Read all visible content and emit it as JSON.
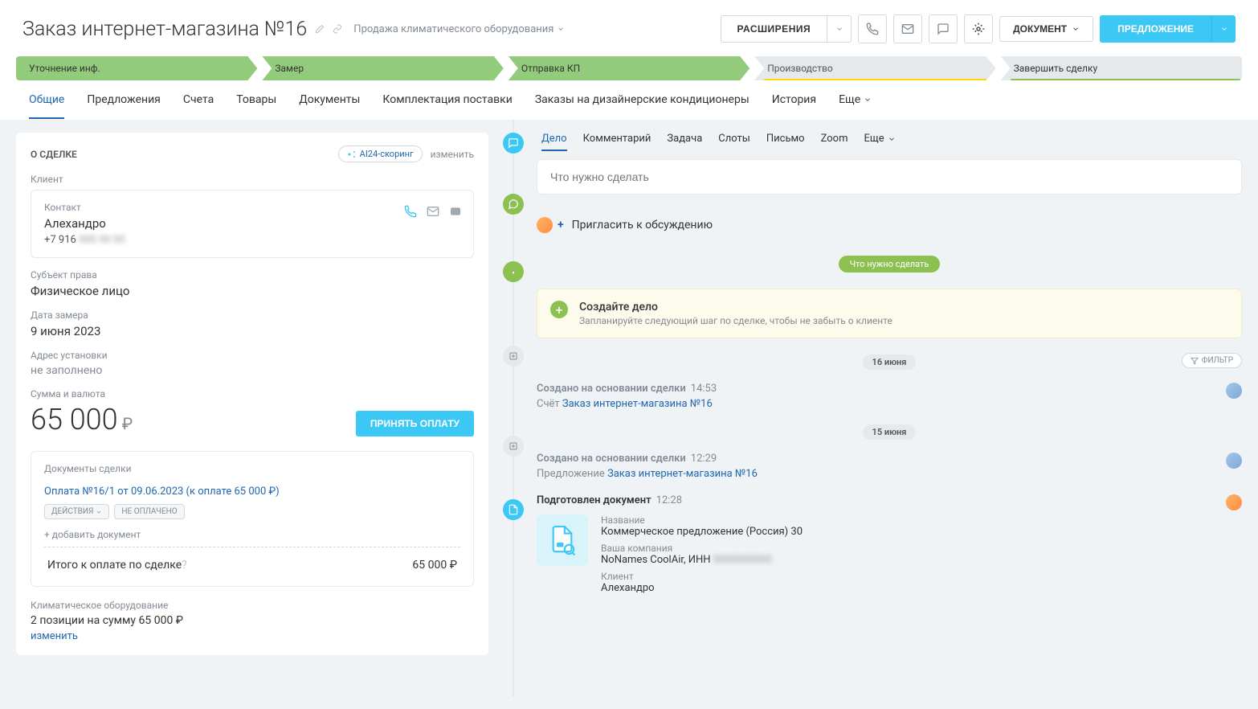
{
  "header": {
    "title": "Заказ интернет-магазина №16",
    "direction": "Продажа климатического оборудования",
    "ext_label": "РАСШИРЕНИЯ",
    "doc_label": "ДОКУМЕНТ",
    "offer_label": "ПРЕДЛОЖЕНИЕ"
  },
  "stages": [
    "Уточнение инф.",
    "Замер",
    "Отправка КП",
    "Производство",
    "Завершить сделку"
  ],
  "tabs": [
    "Общие",
    "Предложения",
    "Счета",
    "Товары",
    "Документы",
    "Комплектация поставки",
    "Заказы на дизайнерские кондиционеры",
    "История",
    "Еще"
  ],
  "deal": {
    "panel_title": "О СДЕЛКЕ",
    "scoring": "AI24-скоринг",
    "scoring_change": "изменить",
    "client_label": "Клиент",
    "contact_label": "Контакт",
    "contact_name": "Алехандро",
    "phone_prefix": "+7 916",
    "phone_hidden": "000 00 00",
    "subject_label": "Субъект права",
    "subject_value": "Физическое лицо",
    "measure_date_label": "Дата замера",
    "measure_date_value": "9 июня 2023",
    "address_label": "Адрес установки",
    "address_value": "не заполнено",
    "amount_label": "Сумма и валюта",
    "amount_value": "65 000",
    "pay_btn": "ПРИНЯТЬ ОПЛАТУ",
    "docs_label": "Документы сделки",
    "doc_link": "Оплата №16/1 от 09.06.2023 (к оплате 65 000 ₽)",
    "actions_badge": "ДЕЙСТВИЯ",
    "unpaid_badge": "НЕ ОПЛАЧЕНО",
    "add_doc": "+ добавить документ",
    "total_label": "Итого к оплате по сделке",
    "total_value": "65 000 ₽",
    "equip_label": "Климатическое оборудование",
    "equip_line": "2 позиции на сумму 65 000 ₽",
    "equip_edit": "изменить"
  },
  "timeline": {
    "tabs": [
      "Дело",
      "Комментарий",
      "Задача",
      "Слоты",
      "Письмо",
      "Zoom",
      "Еще"
    ],
    "todo_placeholder": "Что нужно сделать",
    "invite": "Пригласить к обсуждению",
    "todo_pill": "Что нужно сделать",
    "hint_title": "Создайте дело",
    "hint_text": "Запланируйте следующий шаг по сделке, чтобы не забыть о клиенте",
    "date1": "16 июня",
    "filter": "ФИЛЬТР",
    "ev1_title": "Создано на основании сделки",
    "ev1_time": "14:53",
    "ev1_prefix": "Счёт",
    "ev1_link": "Заказ интернет-магазина №16",
    "date2": "15 июня",
    "ev2_title": "Создано на основании сделки",
    "ev2_time": "12:29",
    "ev2_prefix": "Предложение",
    "ev2_link": "Заказ интернет-магазина №16",
    "ev3_title": "Подготовлен документ",
    "ev3_time": "12:28",
    "doc_name_label": "Название",
    "doc_name_value": "Коммерческое предложение (Россия) 30",
    "doc_company_label": "Ваша компания",
    "doc_company_value": "NoNames CoolAir, ИНН",
    "doc_company_hidden": "0000000000",
    "doc_client_label": "Клиент",
    "doc_client_value": "Алехандро"
  }
}
